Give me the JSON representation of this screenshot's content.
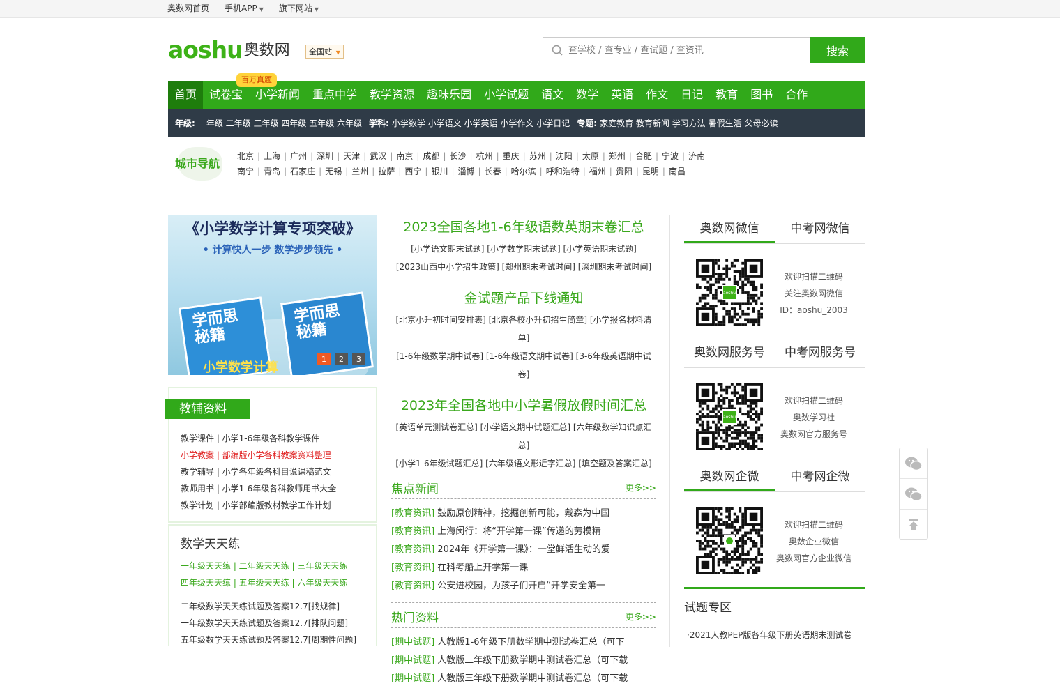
{
  "topbar": {
    "home": "奥数网首页",
    "app": "手机APP",
    "sites": "旗下网站"
  },
  "header": {
    "logo_en_a": "ao",
    "logo_en_b": "shu",
    "logo_cn": "奥数网",
    "station": "全国站",
    "search_placeholder": "查学校 / 查专业 / 查试题 / 查资讯",
    "search_button": "搜索"
  },
  "nav": {
    "badge": "百万真题",
    "items": [
      "首页",
      "试卷宝",
      "小学新闻",
      "重点中学",
      "教学资源",
      "趣味乐园",
      "小学试题",
      "语文",
      "数学",
      "英语",
      "作文",
      "日记",
      "教育",
      "图书",
      "合作"
    ]
  },
  "subnav": {
    "grade_label": "年级:",
    "grades": [
      "一年级",
      "二年级",
      "三年级",
      "四年级",
      "五年级",
      "六年级"
    ],
    "subject_label": "学科:",
    "subjects": [
      "小学数学",
      "小学语文",
      "小学英语",
      "小学作文",
      "小学日记"
    ],
    "topic_label": "专题:",
    "topics": [
      "家庭教育",
      "教育新闻",
      "学习方法",
      "暑假生活",
      "父母必读"
    ]
  },
  "city": {
    "label": "城市导航",
    "row1": [
      "北京",
      "上海",
      "广州",
      "深圳",
      "天津",
      "武汉",
      "南京",
      "成都",
      "长沙",
      "杭州",
      "重庆",
      "苏州",
      "沈阳",
      "太原",
      "郑州",
      "合肥",
      "宁波",
      "济南"
    ],
    "row2": [
      "南宁",
      "青岛",
      "石家庄",
      "无锡",
      "兰州",
      "拉萨",
      "西宁",
      "银川",
      "淄博",
      "长春",
      "哈尔滨",
      "呼和浩特",
      "福州",
      "贵阳",
      "昆明",
      "南昌"
    ]
  },
  "banner": {
    "title": "《小学数学计算专项突破》",
    "subtitle": "• 计算快人一步  数学步步领先 •",
    "book1": "学而思\n秘籍",
    "book2": "学而思\n秘籍",
    "book_bottom": "小学数学计算",
    "pages": [
      "1",
      "2",
      "3"
    ]
  },
  "jiaofu": {
    "title": "教辅资料",
    "items": [
      "教学课件 | 小学1-6年级各科教学课件",
      "小学教案 | 部编版小学各科教案资料整理",
      "教学辅导 | 小学各年级各科目说课稿范文",
      "教师用书 | 小学1-6年级各科教师用书大全",
      "教学计划 | 小学部编版教材教学工作计划"
    ]
  },
  "tiantian": {
    "title": "数学天天练",
    "grades_row1": "一年级天天练 | 二年级天天练 | 三年级天天练",
    "grades_row2": "四年级天天练 | 五年级天天练 | 六年级天天练",
    "list": [
      "二年级数学天天练试题及答案12.7[找规律]",
      "一年级数学天天练试题及答案12.7[排队问题]",
      "五年级数学天天练试题及答案12.7[周期性问题]"
    ]
  },
  "mid": {
    "h1": "2023全国各地1-6年级语数英期末卷汇总",
    "h1_links_a": "[小学语文期末试题] [小学数学期末试题] [小学英语期末试题]",
    "h1_links_b": "[2023山西中小学招生政策] [郑州期末考试时间] [深圳期末考试时间]",
    "h2": "金试题产品下线通知",
    "h2_links_a": "[北京小升初时间安排表] [北京各校小升初招生简章] [小学报名材料清单]",
    "h2_links_b": "[1-6年级数学期中试卷] [1-6年级语文期中试卷] [3-6年级英语期中试卷]",
    "h3": "2023年全国各地中小学暑假放假时间汇总",
    "h3_links_a": "[英语单元测试卷汇总] [小学语文期中试题汇总] [六年级数学知识点汇总]",
    "h3_links_b": "[小学1-6年级试题汇总] [六年级语文形近字汇总] [填空题及答案汇总]",
    "focus_title": "焦点新闻",
    "more": "更多>>",
    "focus": [
      {
        "tag": "[教育资讯]",
        "text": "鼓励原创精神，挖掘创新可能，戴森为中国"
      },
      {
        "tag": "[教育资讯]",
        "text": "上海闵行：将“开学第一课”传递的劳模精"
      },
      {
        "tag": "[教育资讯]",
        "text": "2024年《开学第一课》：一堂鲜活生动的爱"
      },
      {
        "tag": "[教育资讯]",
        "text": "在科考船上开学第一课"
      },
      {
        "tag": "[教育资讯]",
        "text": "公安进校园，为孩子们开启“开学安全第一"
      }
    ],
    "hot_title": "热门资料",
    "hot": [
      {
        "tag": "[期中试题]",
        "text": "人教版1-6年级下册数学期中测试卷汇总（可下"
      },
      {
        "tag": "[期中试题]",
        "text": "人教版二年级下册数学期中测试卷汇总（可下载"
      },
      {
        "tag": "[期中试题]",
        "text": "人教版三年级下册数学期中测试卷汇总（可下载"
      }
    ]
  },
  "right": {
    "weixin_tabs": [
      "奥数网微信",
      "中考网微信"
    ],
    "weixin_text": [
      "欢迎扫描二维码",
      "关注奥数网微信",
      "ID：aoshu_2003"
    ],
    "service_tabs": [
      "奥数网服务号",
      "中考网服务号"
    ],
    "service_text": [
      "欢迎扫描二维码",
      "奥数学习社",
      "奥数网官方服务号"
    ],
    "qiwei_tabs": [
      "奥数网企微",
      "中考网企微"
    ],
    "qiwei_text": [
      "欢迎扫描二维码",
      "奥数企业微信",
      "奥数网官方企业微信"
    ],
    "qr_logo": "aoshu",
    "shiti_title": "试题专区",
    "shiti_item": "·2021人教PEP版各年级下册英语期末测试卷"
  },
  "colors": {
    "accent": "#31a91a",
    "dark_nav": "#2f3b47",
    "orange": "#f5a623"
  }
}
